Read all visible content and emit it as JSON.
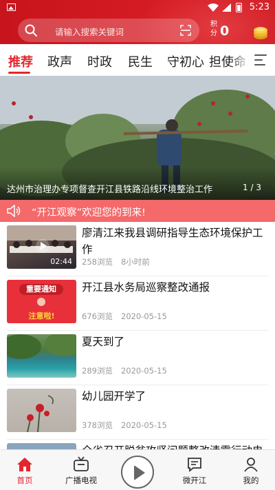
{
  "status_bar": {
    "time": "5:23"
  },
  "header": {
    "search_placeholder": "请输入搜索关键词",
    "points_label": "积分",
    "points_value": "0"
  },
  "tabs": [
    {
      "label": "推荐",
      "active": true
    },
    {
      "label": "政声",
      "active": false
    },
    {
      "label": "时政",
      "active": false
    },
    {
      "label": "民生",
      "active": false
    },
    {
      "label": "守初心",
      "active": false
    },
    {
      "label": "担使命",
      "active": false
    }
  ],
  "banner": {
    "caption": "达州市治理办专项督查开江县铁路沿线环境整治工作",
    "pager": "1 / 3"
  },
  "notice": {
    "text": "“开江观察”欢迎您的到来!"
  },
  "news": [
    {
      "title": "廖清江来我县调研指导生态环境保护工作",
      "views": "258浏览",
      "time": "8小时前",
      "duration": "02:44"
    },
    {
      "title": "开江县水务局巡察整改通报",
      "views": "676浏览",
      "time": "2020-05-15",
      "thumb_text_top": "重要通知",
      "thumb_text_bottom": "注意啦!"
    },
    {
      "title": "夏天到了",
      "views": "289浏览",
      "time": "2020-05-15"
    },
    {
      "title": "幼儿园开学了",
      "views": "378浏览",
      "time": "2020-05-15"
    },
    {
      "title": "全省召开脱贫攻坚问题整改清零行动电",
      "views": "",
      "time": ""
    }
  ],
  "bottom_nav": [
    {
      "label": "首页",
      "icon": "home-icon",
      "active": true
    },
    {
      "label": "广播电视",
      "icon": "tv-icon",
      "active": false
    },
    {
      "label": "",
      "icon": "play-circle-icon",
      "active": false
    },
    {
      "label": "微开江",
      "icon": "chat-icon",
      "active": false
    },
    {
      "label": "我的",
      "icon": "person-icon",
      "active": false
    }
  ],
  "colors": {
    "brand_red": "#d61c24",
    "accent": "#e3262e",
    "notice_bg": "#f4696a"
  }
}
